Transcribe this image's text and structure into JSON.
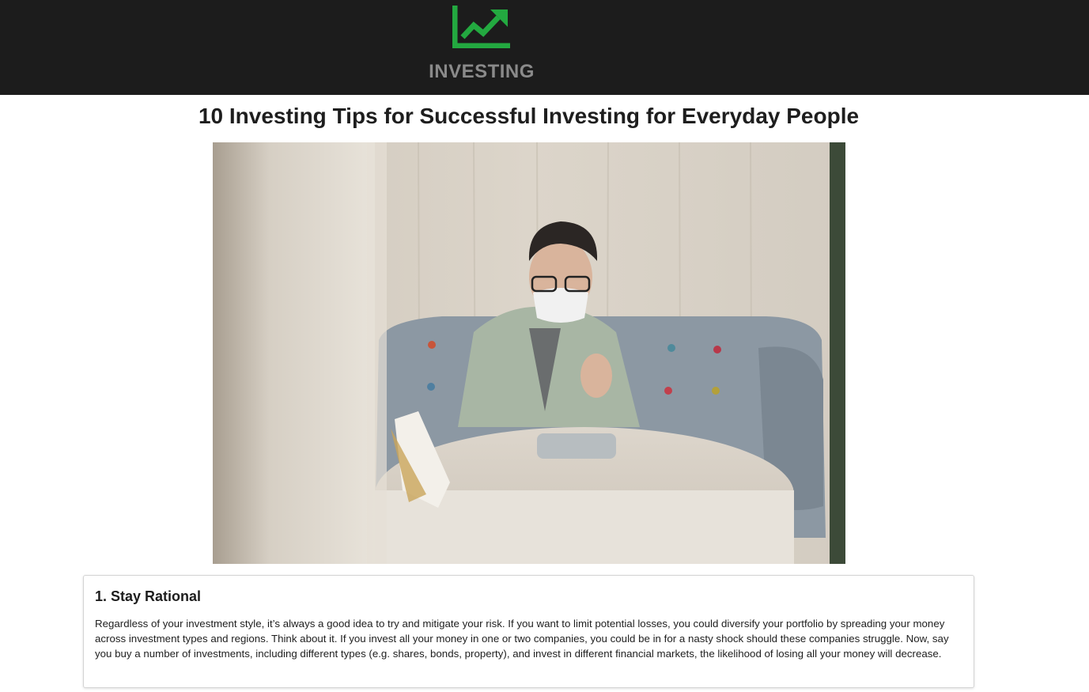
{
  "header": {
    "logo_icon": "chart-trending-up-icon",
    "brand_name": "INVESTING",
    "colors": {
      "background": "#1c1c1c",
      "logo_green": "#23a940",
      "brand_text": "#8a8a8a"
    }
  },
  "article": {
    "title": "10 Investing Tips for Successful Investing for Everyday People",
    "hero_image": "man-wearing-face-mask-using-tablet-on-sofa-photo"
  },
  "tips": [
    {
      "heading": "1. Stay Rational",
      "body": "Regardless of your investment style, it’s always a good idea to try and mitigate your risk. If you want to limit potential losses, you could diversify your portfolio by spreading your money across investment types and regions. Think about it. If you invest all your money in one or two companies, you could be in for a nasty shock should these companies struggle. Now, say you buy a number of investments, including different types (e.g. shares, bonds, property), and invest in different financial markets, the likelihood of losing all your money will decrease."
    }
  ]
}
